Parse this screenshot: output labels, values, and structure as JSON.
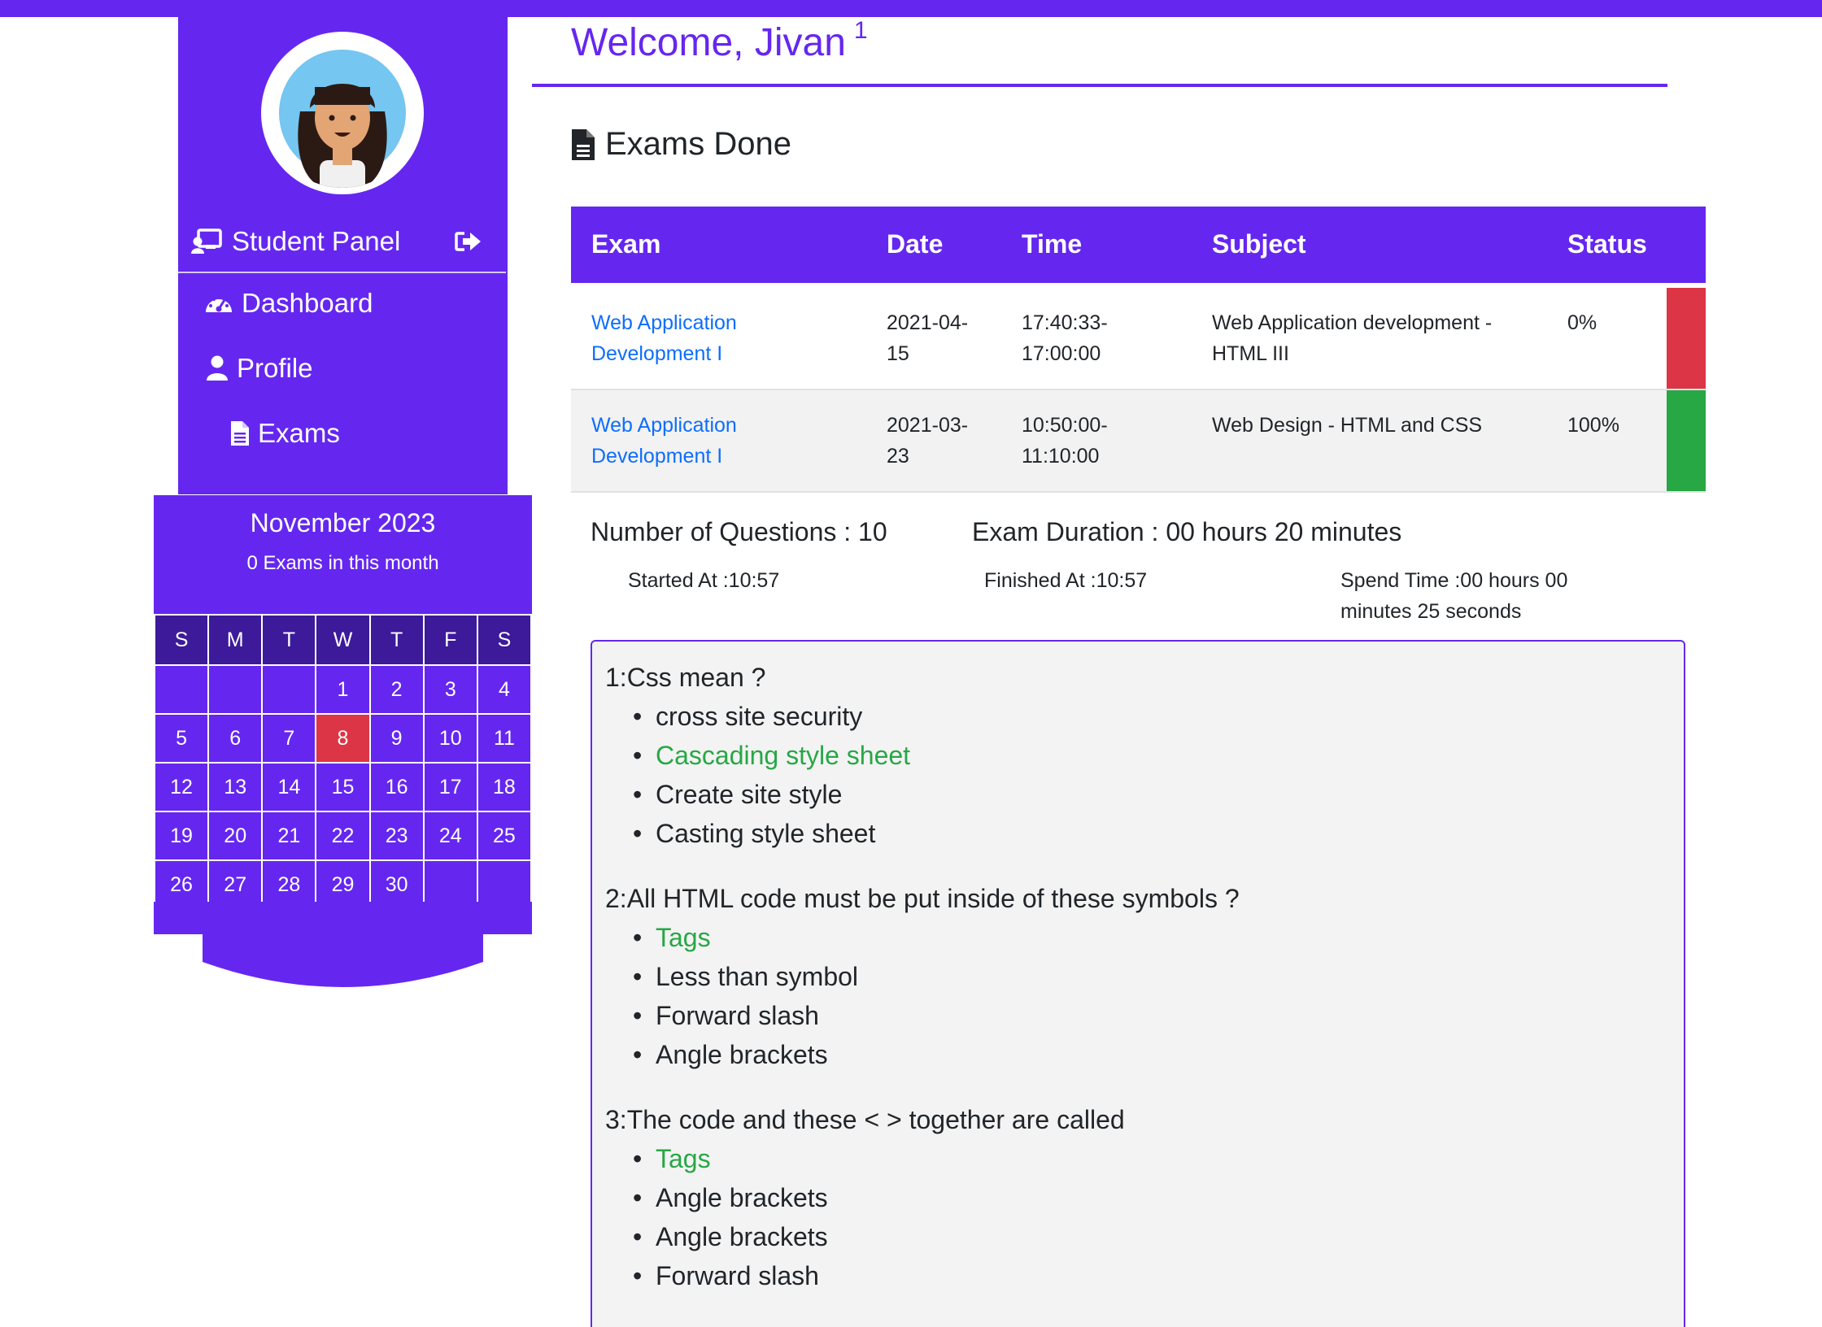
{
  "sidebar": {
    "panel_title": "Student Panel",
    "nav": [
      {
        "label": "Dashboard",
        "icon": "dashboard-gauge-icon"
      },
      {
        "label": "Profile",
        "icon": "user-icon"
      },
      {
        "label": "Exams",
        "icon": "file-icon"
      }
    ]
  },
  "calendar": {
    "month_title": "November 2023",
    "exam_count": "0 Exams in this month",
    "weekdays": [
      "S",
      "M",
      "T",
      "W",
      "T",
      "F",
      "S"
    ],
    "weeks": [
      [
        "",
        "",
        "",
        "1",
        "2",
        "3",
        "4"
      ],
      [
        "5",
        "6",
        "7",
        "8",
        "9",
        "10",
        "11"
      ],
      [
        "12",
        "13",
        "14",
        "15",
        "16",
        "17",
        "18"
      ],
      [
        "19",
        "20",
        "21",
        "22",
        "23",
        "24",
        "25"
      ],
      [
        "26",
        "27",
        "28",
        "29",
        "30",
        "",
        ""
      ]
    ],
    "today": "8",
    "colors": {
      "header": "#6527ef",
      "weekday_bg": "#3d1a9a",
      "today": "#dc3545"
    }
  },
  "main": {
    "welcome": "Welcome, Jivan",
    "welcome_sup": "1",
    "section_title": "Exams Done",
    "table": {
      "headers": [
        "Exam",
        "Date",
        "Time",
        "Subject",
        "Status"
      ],
      "rows": [
        {
          "exam_line1": "Web Application",
          "exam_line2": "Development I",
          "date_line1": "2021-04-",
          "date_line2": "15",
          "time_line1": "17:40:33-",
          "time_line2": "17:00:00",
          "subject_line1": "Web Application development -",
          "subject_line2": "HTML III",
          "status": "0%",
          "status_color": "#dc3545"
        },
        {
          "exam_line1": "Web Application",
          "exam_line2": "Development I",
          "date_line1": "2021-03-",
          "date_line2": "23",
          "time_line1": "10:50:00-",
          "time_line2": "11:10:00",
          "subject_line1": "Web Design - HTML and CSS",
          "subject_line2": "",
          "status": "100%",
          "status_color": "#28a745"
        }
      ]
    },
    "summary": {
      "questions": "Number of Questions : 10",
      "duration": "Exam Duration : 00 hours 20 minutes",
      "started": "Started At :10:57",
      "finished": "Finished At :10:57",
      "spend_line1": "Spend Time :00 hours 00",
      "spend_line2": "minutes 25 seconds"
    },
    "questions": [
      {
        "title": "1:Css mean ?",
        "options": [
          "cross site security",
          "Cascading style sheet",
          "Create site style",
          "Casting style sheet"
        ],
        "correct_index": 1
      },
      {
        "title": "2:All HTML code must be put inside of these symbols ?",
        "options": [
          "Tags",
          "Less than symbol",
          "Forward slash",
          "Angle brackets"
        ],
        "correct_index": 0
      },
      {
        "title": "3:The code and these < > together are called",
        "options": [
          "Tags",
          "Angle brackets",
          "Angle brackets",
          "Forward slash"
        ],
        "correct_index": 0
      }
    ]
  },
  "colors": {
    "accent": "#6527ef",
    "link": "#0d6efd",
    "correct": "#28a745"
  }
}
